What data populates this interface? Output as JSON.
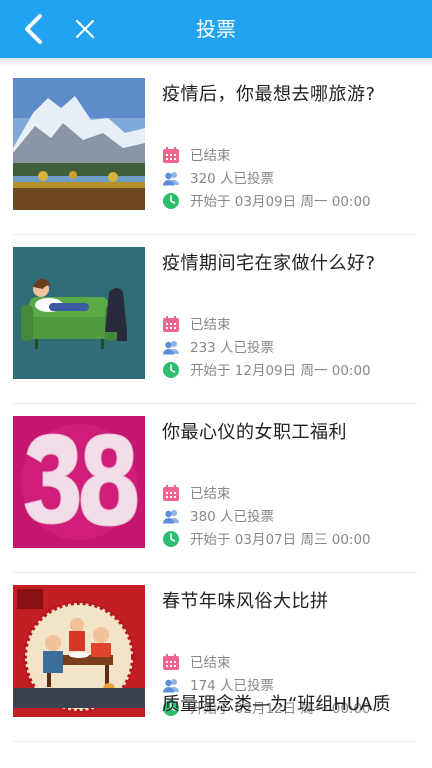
{
  "header": {
    "title": "投票",
    "back_icon": "back-chevron-icon",
    "close_icon": "close-icon",
    "color": "#21a3f1"
  },
  "items": [
    {
      "title": "疫情后，你最想去哪旅游?",
      "status": "已结束",
      "votes": "320 人已投票",
      "start": "开始于 03月09日 周一 00:00"
    },
    {
      "title": "疫情期间宅在家做什么好?",
      "status": "已结束",
      "votes": "233 人已投票",
      "start": "开始于 12月09日 周一 00:00"
    },
    {
      "title": "你最心仪的女职工福利",
      "status": "已结束",
      "votes": "380 人已投票",
      "start": "开始于 03月07日 周三 00:00"
    },
    {
      "title": "春节年味风俗大比拼",
      "status": "已结束",
      "votes": "174 人已投票",
      "start": "开始于 02月12日 周一 00:00"
    }
  ],
  "partial_item": {
    "title": "质量理念类—为“班组HUA质"
  },
  "icons": {
    "calendar": "calendar-icon",
    "people": "people-icon",
    "clock": "clock-icon"
  },
  "colors": {
    "calendar": "#f0648e",
    "people": "#5b8fd9",
    "clock": "#2dbd6e"
  }
}
